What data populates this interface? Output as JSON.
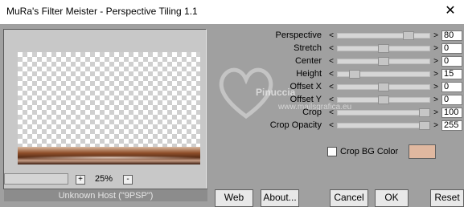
{
  "window": {
    "title": "MuRa's Filter Meister - Perspective Tiling 1.1",
    "close_glyph": "✕"
  },
  "zoom": {
    "minus": "-",
    "plus": "+",
    "value": "25%"
  },
  "status_text": "Unknown Host (\"9PSP\")",
  "watermark": {
    "line1": "Pinuccia",
    "line2": "www.mailsgrafica.eu"
  },
  "controls": [
    {
      "label": "Perspective",
      "value": "80",
      "level": 0.8
    },
    {
      "label": "Stretch",
      "value": "0",
      "level": 0.5
    },
    {
      "label": "Center",
      "value": "0",
      "level": 0.5
    },
    {
      "label": "Height",
      "value": "15",
      "level": 0.15
    },
    {
      "label": "Offset X",
      "value": "0",
      "level": 0.5
    },
    {
      "label": "Offset Y",
      "value": "0",
      "level": 0.5
    },
    {
      "label": "Crop",
      "value": "100",
      "level": 1.0
    },
    {
      "label": "Crop Opacity",
      "value": "255",
      "level": 1.0
    }
  ],
  "crop_bg": {
    "label": "Crop BG Color",
    "checked": false,
    "color": "#e0b8a0"
  },
  "buttons": {
    "web": "Web",
    "about": "About...",
    "cancel": "Cancel",
    "ok": "OK",
    "reset": "Reset"
  },
  "arrows": {
    "left": "<",
    "right": ">"
  }
}
